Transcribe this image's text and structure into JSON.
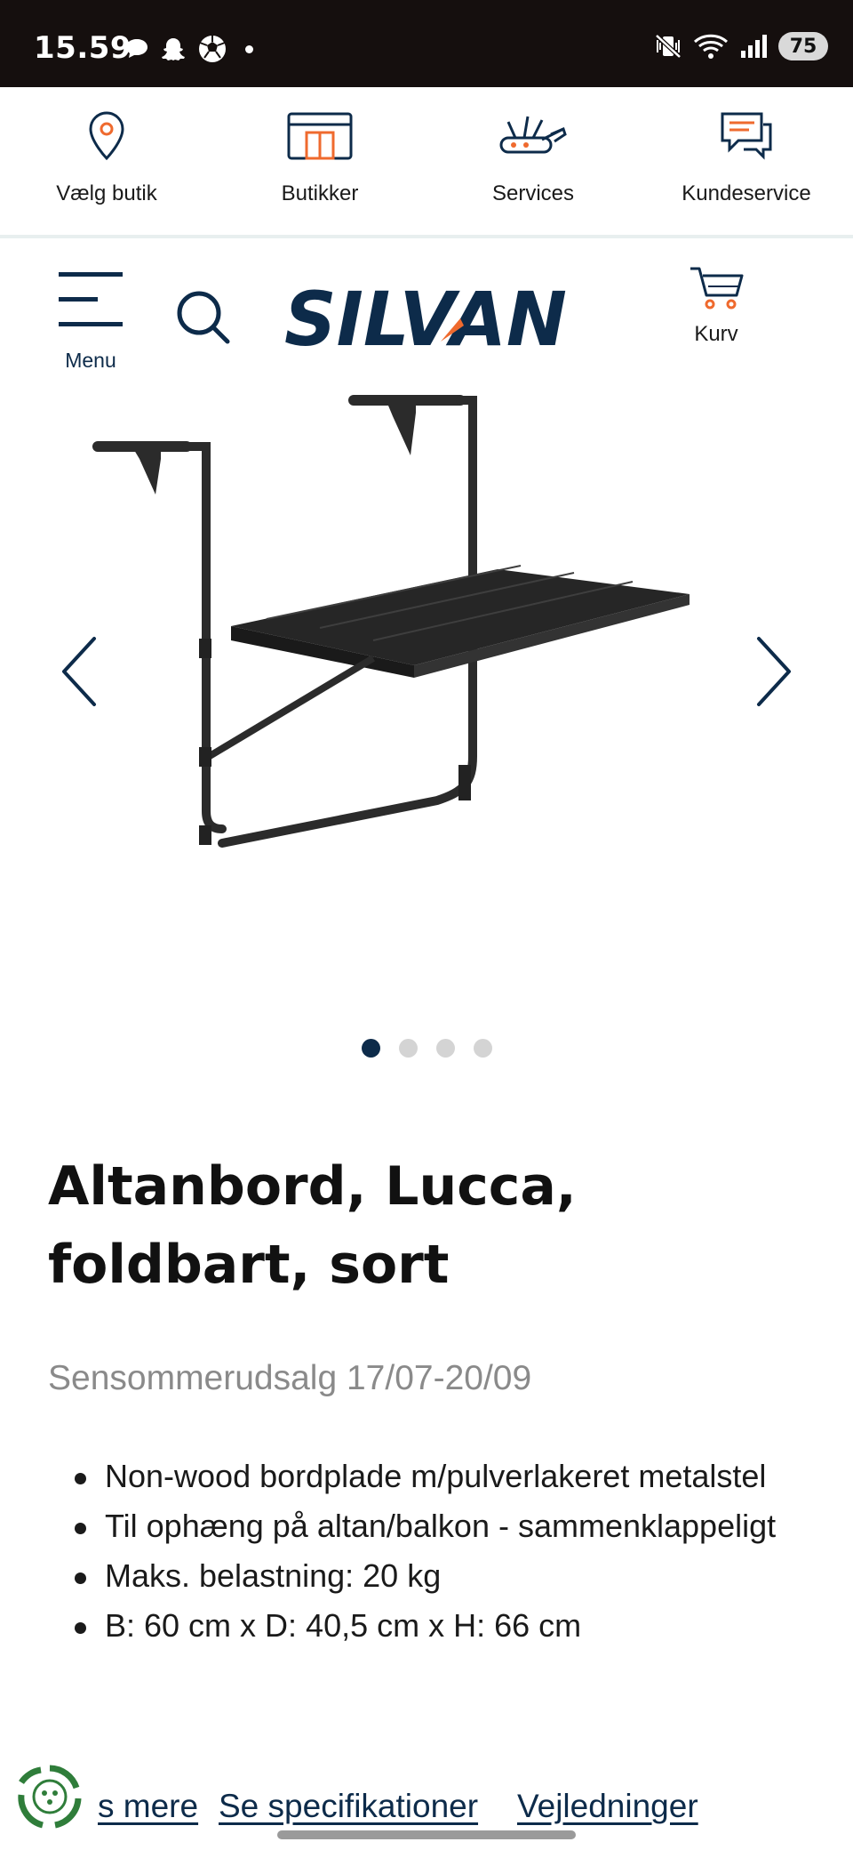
{
  "status_bar": {
    "time": "15.59",
    "left_icons": [
      "chat-bubble-icon",
      "snapchat-ghost-icon",
      "soccer-ball-icon",
      "notification-dot"
    ],
    "right_icons": [
      "mute-vibrate-icon",
      "wifi-icon",
      "signal-bars-icon"
    ],
    "battery": "75"
  },
  "util_nav": [
    {
      "label": "Vælg butik",
      "icon": "location-pin-icon"
    },
    {
      "label": "Butikker",
      "icon": "store-icon"
    },
    {
      "label": "Services",
      "icon": "tools-icon"
    },
    {
      "label": "Kundeservice",
      "icon": "chat-icon"
    }
  ],
  "header": {
    "menu_label": "Menu",
    "logo_text": "SILVAN",
    "cart_label": "Kurv"
  },
  "carousel": {
    "image_alt": "Altanbord, Lucca, foldbart, sort",
    "slide_count": 4,
    "active_slide": 1
  },
  "product": {
    "title": "Altanbord, Lucca, foldbart, sort",
    "campaign": "Sensommerudsalg 17/07-20/09",
    "features": [
      "Non-wood bordplade m/pulverlakeret metalstel",
      "Til ophæng på altan/balkon - sammenklappeligt",
      "Maks. belastning: 20 kg",
      "B: 60 cm x D: 40,5 cm x H: 66 cm"
    ]
  },
  "bottom_links": {
    "read_more": "s mere",
    "specs": "Se specifikationer",
    "guides": "Vejledninger"
  },
  "colors": {
    "brand_navy": "#0d2b4a",
    "brand_orange": "#ef6a2e",
    "status_bar_bg": "#150f0e",
    "campaign_gray": "#8a8a8a"
  }
}
